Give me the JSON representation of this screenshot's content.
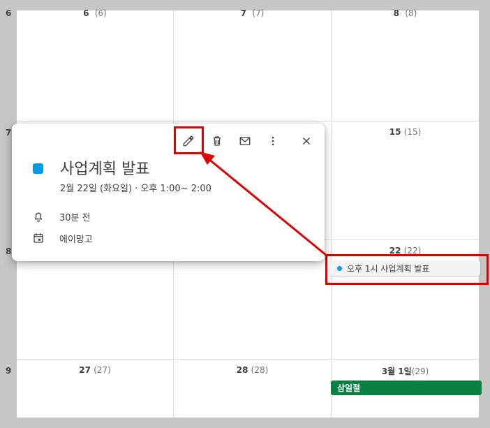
{
  "calendar": {
    "edge_numbers": [
      "6",
      "7",
      "8",
      "9"
    ],
    "week1": [
      {
        "day": "6",
        "paren": "(6)"
      },
      {
        "day": "7",
        "paren": "(7)"
      },
      {
        "day": "8",
        "paren": "(8)"
      }
    ],
    "week2": [
      {
        "day": "15",
        "paren": "(15)"
      }
    ],
    "week3": [
      {
        "day": "22",
        "paren": "(22)"
      }
    ],
    "week4": [
      {
        "day": "27",
        "paren": "(27)"
      },
      {
        "day": "28",
        "paren": "(28)"
      },
      {
        "day": "3월 1일",
        "paren": "(29)"
      }
    ],
    "event_chip_label": "오후 1시 사업계획 발표",
    "holiday_label": "삼일절",
    "event_color": "#039be5",
    "holiday_color": "#0b8043"
  },
  "popover": {
    "title": "사업계획 발표",
    "datetime": "2월 22일 (화요일)  ·  오후 1:00~ 2:00",
    "reminder": "30분 전",
    "calendar_name": "에이망고",
    "icons": [
      "pencil-icon",
      "trash-icon",
      "mail-icon",
      "more-vert-icon",
      "close-icon",
      "bell-icon",
      "calendar-icon"
    ]
  },
  "annotation_color": "#e00000"
}
